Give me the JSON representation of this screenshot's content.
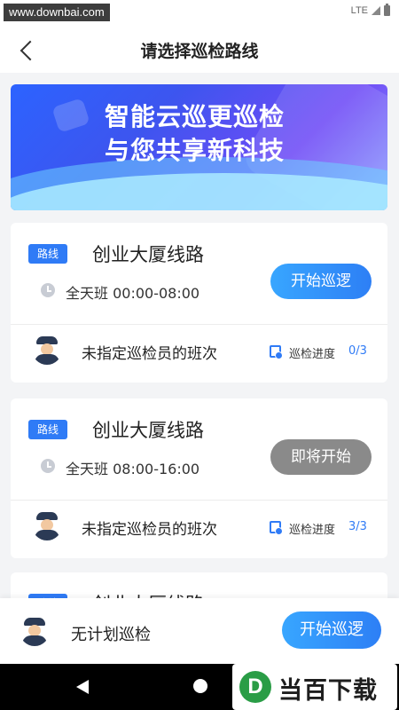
{
  "status_bar": {
    "watermark_url": "www.downbai.com",
    "network": "LTE"
  },
  "header": {
    "title": "请选择巡检路线"
  },
  "banner": {
    "line1": "智能云巡更巡检",
    "line2": "与您共享新科技"
  },
  "routes": [
    {
      "tag": "路线",
      "name": "创业大厦线路",
      "shift_time": "全天班 00:00-08:00",
      "button": "开始巡逻",
      "button_state": "active",
      "shift_desc": "未指定巡检员的班次",
      "progress_label": "巡检进度",
      "progress_value": "0/3"
    },
    {
      "tag": "路线",
      "name": "创业大厦线路",
      "shift_time": "全天班 08:00-16:00",
      "button": "即将开始",
      "button_state": "disabled",
      "shift_desc": "未指定巡检员的班次",
      "progress_label": "巡检进度",
      "progress_value": "3/3"
    },
    {
      "tag": "路线",
      "name": "创业大厦线路"
    }
  ],
  "bottom_bar": {
    "label": "无计划巡检",
    "button": "开始巡逻"
  },
  "watermark": {
    "logo_letter": "D",
    "text": "当百下载"
  },
  "colors": {
    "accent": "#2f7bf6",
    "disabled": "#8a8a8a",
    "background": "#f3f4f6"
  }
}
